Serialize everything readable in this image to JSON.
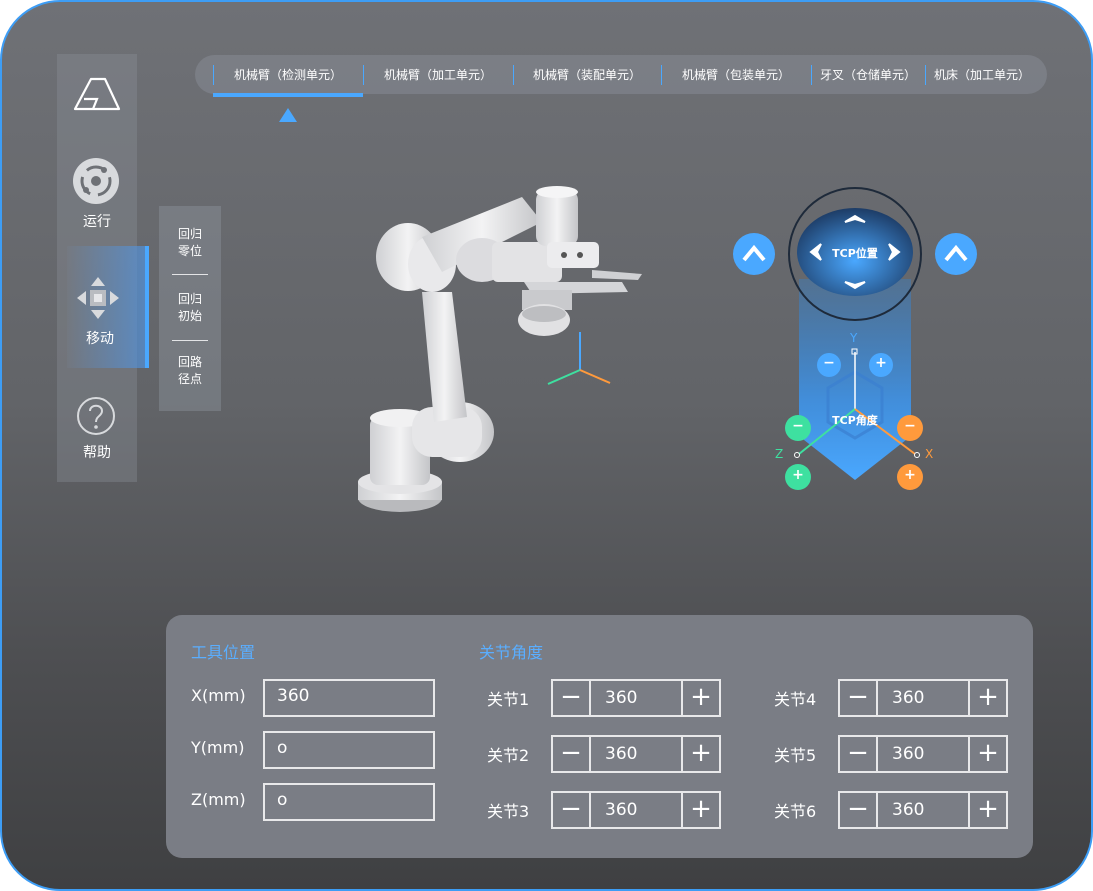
{
  "tabs": [
    {
      "label": "机械臂（检测单元）"
    },
    {
      "label": "机械臂（加工单元）"
    },
    {
      "label": "机械臂（装配单元）"
    },
    {
      "label": "机械臂（包装单元）"
    },
    {
      "label": "牙叉（仓储单元）"
    },
    {
      "label": "机床（加工单元）"
    }
  ],
  "sidebar": {
    "logo_icon": "logo-icon",
    "items": [
      {
        "label": "运行",
        "icon": "run-icon"
      },
      {
        "label": "移动",
        "icon": "move-icon"
      },
      {
        "label": "帮助",
        "icon": "help-icon"
      }
    ]
  },
  "submenu": {
    "items": [
      {
        "line1": "回归",
        "line2": "零位"
      },
      {
        "line1": "回归",
        "line2": "初始"
      },
      {
        "line1": "回路",
        "line2": "径点"
      }
    ]
  },
  "control": {
    "tcp_position_label": "TCP位置",
    "tcp_angle_label": "TCP角度",
    "axis_x": "X",
    "axis_y": "Y",
    "axis_z": "Z",
    "minus": "−",
    "plus": "+"
  },
  "tool_position": {
    "title": "工具位置",
    "fields": [
      {
        "label": "X(mm)",
        "value": "360"
      },
      {
        "label": "Y(mm)",
        "value": "o"
      },
      {
        "label": "Z(mm)",
        "value": "o"
      }
    ]
  },
  "joint_angles": {
    "title": "关节角度",
    "joints": [
      {
        "label": "关节1",
        "value": "360"
      },
      {
        "label": "关节2",
        "value": "360"
      },
      {
        "label": "关节3",
        "value": "360"
      },
      {
        "label": "关节4",
        "value": "360"
      },
      {
        "label": "关节5",
        "value": "360"
      },
      {
        "label": "关节6",
        "value": "360"
      }
    ],
    "minus": "−",
    "plus": "+"
  },
  "colors": {
    "accent": "#4aa8ff",
    "green": "#3ee0a0",
    "orange": "#ff9a3c",
    "frame_border": "#3d9df5"
  }
}
